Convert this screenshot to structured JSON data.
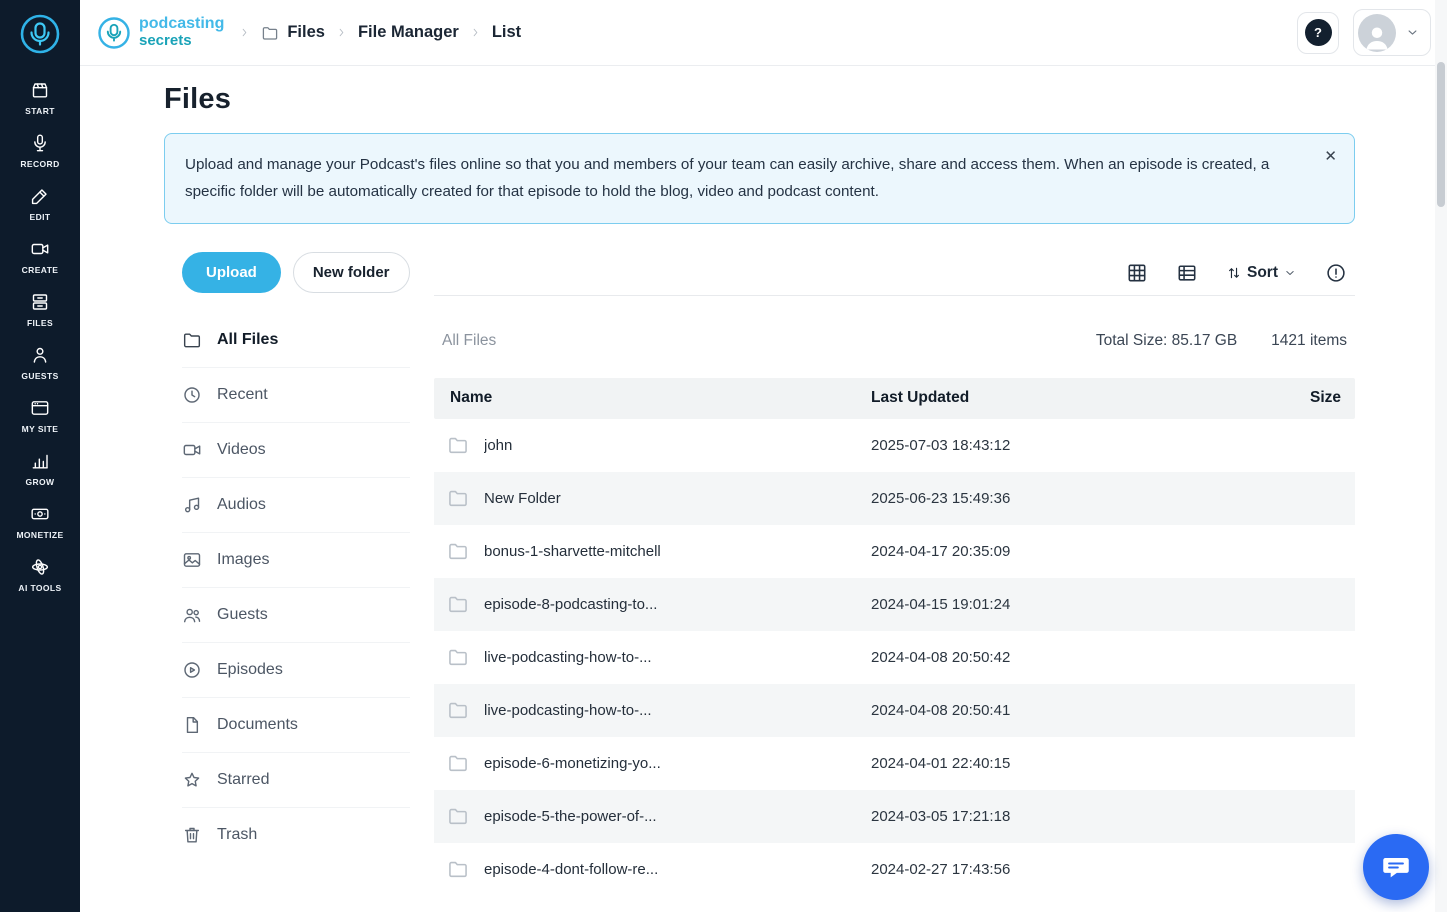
{
  "colors": {
    "accent": "#35b2e5",
    "sidebar_bg": "#0d1b2b",
    "banner_bg": "#ecf7fd",
    "banner_border": "#7ccdef",
    "chat_bg": "#2a6af3",
    "brand_blue": "#43b9e8",
    "brand_teal": "#1aa3b8"
  },
  "header": {
    "logo_top": "podcasting",
    "logo_bottom": "secrets",
    "breadcrumb": [
      "Files",
      "File Manager",
      "List"
    ],
    "help_glyph": "?"
  },
  "sidebar": {
    "items": [
      {
        "label": "START",
        "icon": "start-icon"
      },
      {
        "label": "RECORD",
        "icon": "record-icon"
      },
      {
        "label": "EDIT",
        "icon": "edit-icon"
      },
      {
        "label": "CREATE",
        "icon": "create-icon"
      },
      {
        "label": "FILES",
        "icon": "files-icon"
      },
      {
        "label": "GUESTS",
        "icon": "guests-icon"
      },
      {
        "label": "MY SITE",
        "icon": "mysite-icon"
      },
      {
        "label": "GROW",
        "icon": "grow-icon"
      },
      {
        "label": "MONETIZE",
        "icon": "monetize-icon"
      },
      {
        "label": "AI TOOLS",
        "icon": "aitools-icon"
      }
    ]
  },
  "page": {
    "title": "Files",
    "banner_text": "Upload and manage your Podcast's files online so that you and members of your team can easily archive, share and access them. When an episode is created, a specific folder will be automatically created for that episode to hold the blog, video and podcast content.",
    "close_glyph": "✕"
  },
  "filter_panel": {
    "upload_label": "Upload",
    "new_folder_label": "New folder",
    "items": [
      {
        "label": "All Files",
        "icon": "folder-icon",
        "active": true
      },
      {
        "label": "Recent",
        "icon": "clock-icon"
      },
      {
        "label": "Videos",
        "icon": "video-icon"
      },
      {
        "label": "Audios",
        "icon": "audio-icon"
      },
      {
        "label": "Images",
        "icon": "image-icon"
      },
      {
        "label": "Guests",
        "icon": "guests2-icon"
      },
      {
        "label": "Episodes",
        "icon": "episode-icon"
      },
      {
        "label": "Documents",
        "icon": "document-icon"
      },
      {
        "label": "Starred",
        "icon": "star-icon"
      },
      {
        "label": "Trash",
        "icon": "trash-icon"
      }
    ]
  },
  "toolbar": {
    "sort_label": "Sort"
  },
  "list": {
    "section_label": "All Files",
    "total_size": "Total Size: 85.17 GB",
    "items_count": "1421 items",
    "columns": {
      "name": "Name",
      "updated": "Last Updated",
      "size": "Size"
    },
    "rows": [
      {
        "name": "john",
        "updated": "2025-07-03 18:43:12",
        "size": ""
      },
      {
        "name": "New Folder",
        "updated": "2025-06-23 15:49:36",
        "size": ""
      },
      {
        "name": "bonus-1-sharvette-mitchell",
        "updated": "2024-04-17 20:35:09",
        "size": ""
      },
      {
        "name": "episode-8-podcasting-to...",
        "updated": "2024-04-15 19:01:24",
        "size": ""
      },
      {
        "name": "live-podcasting-how-to-...",
        "updated": "2024-04-08 20:50:42",
        "size": ""
      },
      {
        "name": "live-podcasting-how-to-...",
        "updated": "2024-04-08 20:50:41",
        "size": ""
      },
      {
        "name": "episode-6-monetizing-yo...",
        "updated": "2024-04-01 22:40:15",
        "size": ""
      },
      {
        "name": "episode-5-the-power-of-...",
        "updated": "2024-03-05 17:21:18",
        "size": ""
      },
      {
        "name": "episode-4-dont-follow-re...",
        "updated": "2024-02-27 17:43:56",
        "size": ""
      }
    ]
  }
}
